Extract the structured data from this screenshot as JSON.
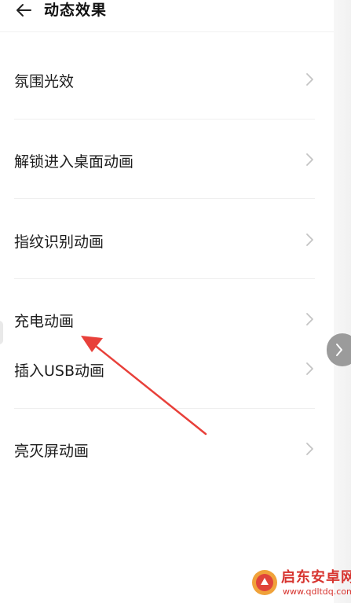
{
  "header": {
    "title": "动态效果",
    "back_icon": "arrow-left-icon"
  },
  "settings": {
    "items": [
      {
        "label": "氛围光效",
        "icon": "chevron-right-icon"
      },
      {
        "label": "解锁进入桌面动画",
        "icon": "chevron-right-icon"
      },
      {
        "label": "指纹识别动画",
        "icon": "chevron-right-icon"
      },
      {
        "label": "充电动画",
        "icon": "chevron-right-icon"
      },
      {
        "label": "插入USB动画",
        "icon": "chevron-right-icon"
      },
      {
        "label": "亮灭屏动画",
        "icon": "chevron-right-icon"
      }
    ]
  },
  "side_handle": {
    "icon": "chevron-right-icon"
  },
  "annotation": {
    "color": "#e8403a",
    "target": "充电动画"
  },
  "watermark": {
    "name": "启东安卓网",
    "url": "www.qdltdq.com",
    "color": "#d7342f"
  }
}
